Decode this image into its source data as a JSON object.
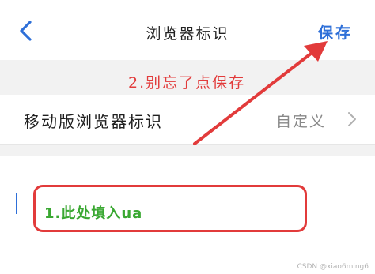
{
  "navbar": {
    "title": "浏览器标识",
    "save_label": "保存",
    "back_icon": "chevron-left-icon"
  },
  "annotations": {
    "step2": "2.别忘了点保存",
    "step1": "1.此处填入ua"
  },
  "setting_row": {
    "label": "移动版浏览器标识",
    "value": "自定义",
    "chevron_icon": "chevron-right-icon"
  },
  "input": {
    "value": ""
  },
  "watermark": "CSDN @xiao6ming6",
  "colors": {
    "accent": "#2e6fd8",
    "annotation_red": "#e23b3b",
    "annotation_green": "#3aa832",
    "band_gray": "#f2f2f2"
  }
}
